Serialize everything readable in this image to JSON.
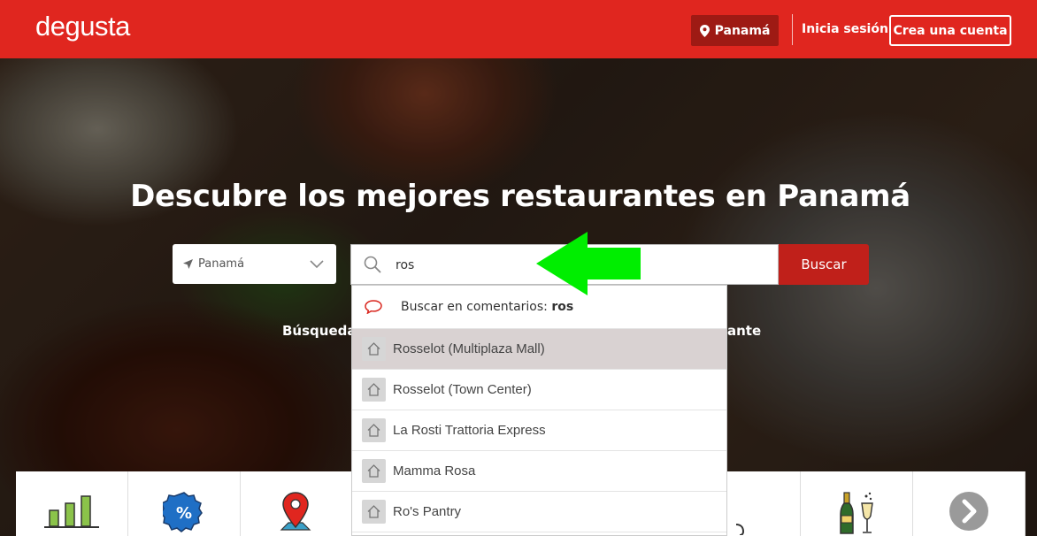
{
  "header": {
    "logo": "degusta",
    "location_button": "Panamá",
    "login": "Inicia sesión",
    "signup": "Crea una cuenta"
  },
  "hero": {
    "title": "Descubre los mejores restaurantes en Panamá",
    "city_select": "Panamá",
    "search_value": "ros",
    "search_button": "Buscar",
    "partial_left": "Búsqueda",
    "partial_right": "ante"
  },
  "dropdown": {
    "comments_label": "Buscar en comentarios:",
    "comments_term": "ros",
    "items": [
      {
        "label": "Rosselot (Multiplaza Mall)",
        "active": true
      },
      {
        "label": "Rosselot (Town Center)"
      },
      {
        "label": "La Rosti Trattoria Express"
      },
      {
        "label": "Mamma Rosa"
      },
      {
        "label": "Ro's Pantry"
      }
    ]
  },
  "categories": [
    {
      "icon": "bar-chart-icon"
    },
    {
      "icon": "discount-badge-icon"
    },
    {
      "icon": "map-pin-icon"
    },
    {
      "icon": "category-icon"
    },
    {
      "icon": "category-icon"
    },
    {
      "icon": "category-icon"
    },
    {
      "icon": "shield-icon"
    },
    {
      "icon": "champagne-icon"
    },
    {
      "icon": "chevron-right-icon"
    }
  ],
  "colors": {
    "brand_red": "#e0261f",
    "dark_red": "#9e1a14",
    "button_red": "#c0201a",
    "arrow_green": "#00ee00",
    "bar_green": "#8bc34a"
  }
}
